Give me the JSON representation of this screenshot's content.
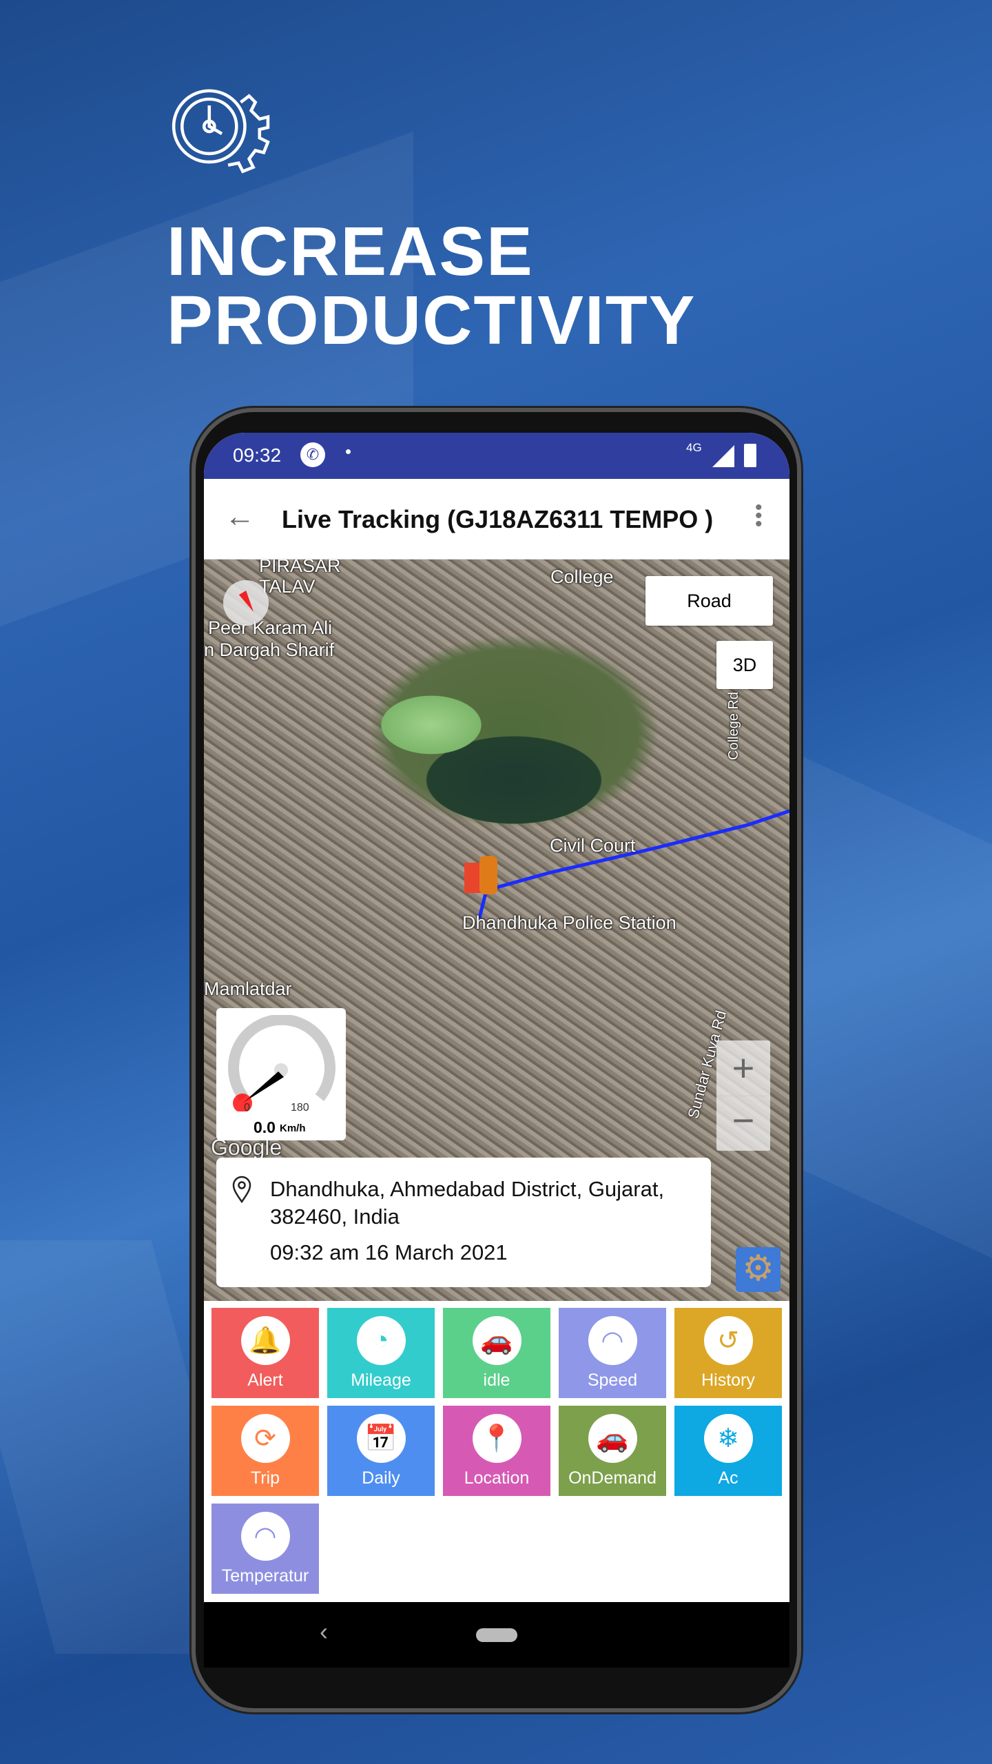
{
  "hero": {
    "icon": "clock-gear-icon",
    "line1": "INCREASE",
    "line2": "PRODUCTIVITY"
  },
  "status_bar": {
    "time": "09:32",
    "call_icon": "phone-icon",
    "network": "4G",
    "signal_icon": "signal-icon",
    "battery_icon": "battery-charging-icon"
  },
  "app_bar": {
    "back_icon": "arrow-left-icon",
    "title": "Live Tracking (GJ18AZ6311 TEMPO )",
    "menu_icon": "more-vert-icon"
  },
  "map": {
    "labels": {
      "pirasar": "PIRASAR",
      "talav": "TALAV",
      "peer": "Peer Karam Ali",
      "dargah": "n Dargah Sharif",
      "college": "College",
      "civil_court": "Civil Court",
      "police": "Dhandhuka Police Station",
      "mamlatdar": "Mamlatdar",
      "college_rd": "College Rd",
      "sundar": "Sundar Kuva Rd",
      "google": "Google"
    },
    "road_button": "Road",
    "three_d_button": "3D",
    "zoom_in": "+",
    "zoom_out": "−",
    "route_color": "#1a2cff",
    "speedometer": {
      "min": "0",
      "max": "180",
      "value": "0.0",
      "unit": "Km/h"
    }
  },
  "info_card": {
    "address": "Dhandhuka, Ahmedabad District, Gujarat, 382460, India",
    "datetime": "09:32 am 16 March 2021"
  },
  "menu": [
    {
      "label": "Alert",
      "color": "#f25c5c",
      "icon": "bell-icon"
    },
    {
      "label": "Mileage",
      "color": "#33cccc",
      "icon": "gauge-icon"
    },
    {
      "label": "idle",
      "color": "#5bd08a",
      "icon": "car-signal-icon"
    },
    {
      "label": "Speed",
      "color": "#8e97e8",
      "icon": "speedometer-icon"
    },
    {
      "label": "History",
      "color": "#dca727",
      "icon": "history-icon"
    },
    {
      "label": "Trip",
      "color": "#ff8046",
      "icon": "recycle-arrows-icon"
    },
    {
      "label": "Daily",
      "color": "#4e8ef0",
      "icon": "calendar-clock-icon"
    },
    {
      "label": "Location",
      "color": "#d65ab4",
      "icon": "location-pin-icon"
    },
    {
      "label": "OnDemand",
      "color": "#7da04c",
      "icon": "car-signal-icon"
    },
    {
      "label": "Ac",
      "color": "#0ea8e3",
      "icon": "snowflake-icon"
    },
    {
      "label": "Temperatur",
      "color": "#8e8ee0",
      "icon": "speedometer-icon"
    }
  ]
}
